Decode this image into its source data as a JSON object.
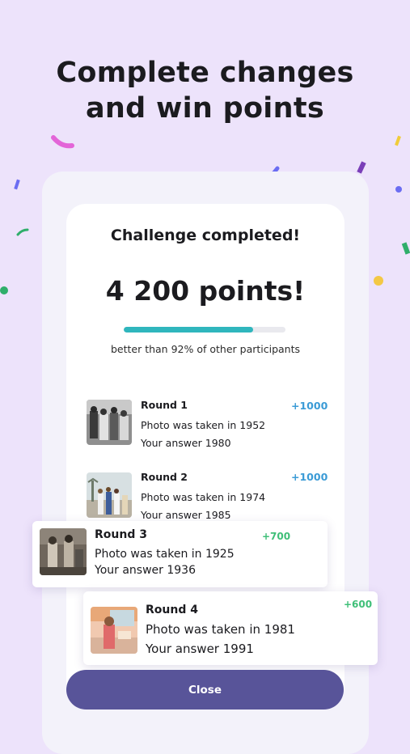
{
  "headline": {
    "line1": "Complete changes",
    "line2": "and win points"
  },
  "summary": {
    "title": "Challenge completed!",
    "points": "4 200 points!",
    "progress_fraction": 0.8,
    "better_text": "better than 92% of other participants"
  },
  "rounds": [
    {
      "title": "Round 1",
      "taken": "Photo was taken in 1952",
      "answer": "Your answer 1980",
      "score": "+1000"
    },
    {
      "title": "Round 2",
      "taken": "Photo was taken in 1974",
      "answer": "Your answer 1985",
      "score": "+1000"
    },
    {
      "title": "Round 3",
      "taken": "Photo was taken in 1925",
      "answer": "Your answer 1936",
      "score": "+700"
    },
    {
      "title": "Round 4",
      "taken": "Photo was taken in 1981",
      "answer": "Your answer 1991",
      "score": "+600"
    }
  ],
  "close_label": "Close",
  "colors": {
    "background": "#ede3fb",
    "accent_teal": "#2fb6bd",
    "button": "#585499",
    "score_blue": "#3b9bd6",
    "score_green": "#3fbf78"
  }
}
